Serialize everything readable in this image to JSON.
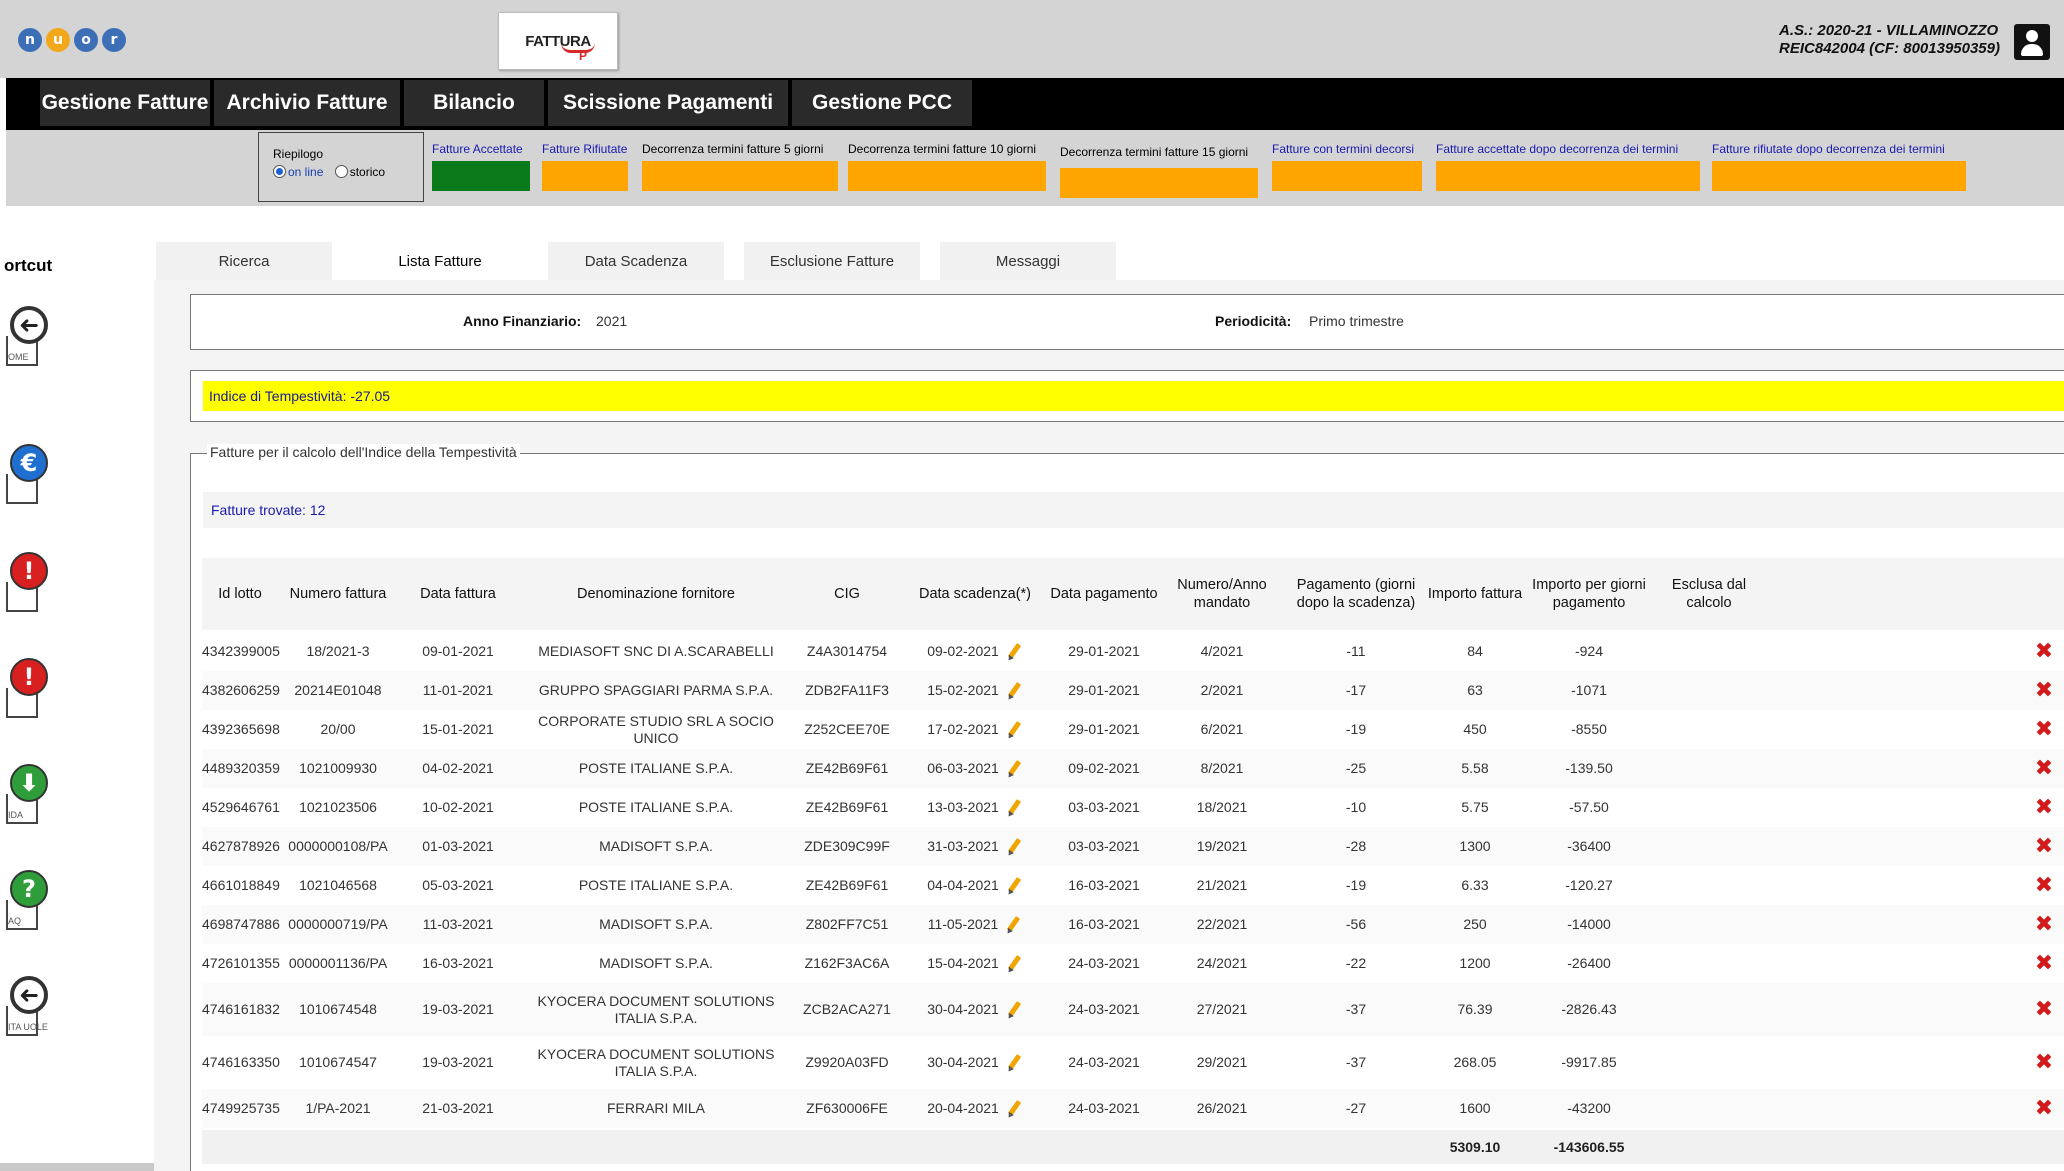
{
  "header": {
    "logo_letters": [
      "n",
      "u",
      "o",
      "r"
    ],
    "logo_colors": [
      "#3d6fb6",
      "#f3a81b",
      "#3d6fb6",
      "#3d6fb6"
    ],
    "fattura_logo": "FATTURA",
    "fattura_logo_sub": "P",
    "school_line1": "A.S.: 2020-21  - VILLAMINOZZO",
    "school_line2": "REIC842004  (CF: 80013950359)"
  },
  "nav": {
    "items": [
      "Gestione Fatture",
      "Archivio Fatture",
      "Bilancio",
      "Scissione Pagamenti",
      "Gestione PCC"
    ]
  },
  "filter": {
    "riepilogo_title": "Riepilogo",
    "option_online": "on line",
    "option_storico": "storico",
    "items": [
      {
        "label": "Fatture Accettate",
        "color": "#0a7a1a"
      },
      {
        "label": "Fatture Rifiutate",
        "color": "#ffa500"
      },
      {
        "label": "Decorrenza termini fatture 5 giorni",
        "color": "#ffa500"
      },
      {
        "label": "Decorrenza termini fatture 10 giorni",
        "color": "#ffa500"
      },
      {
        "label": "Decorrenza termini fatture 15 giorni",
        "color": "#ffa500"
      },
      {
        "label": "Fatture con termini decorsi",
        "color": "#ffa500"
      },
      {
        "label": "Fatture accettate dopo decorrenza dei termini",
        "color": "#ffa500"
      },
      {
        "label": "Fatture rifiutate dopo decorrenza dei termini",
        "color": "#ffa500"
      }
    ]
  },
  "sidebar": {
    "title": "ortcut",
    "shortcuts": [
      {
        "icon": "back-arrow-icon",
        "glyph": "➜",
        "color": "#ffffff",
        "caption": "OME"
      },
      {
        "icon": "euro-icon",
        "glyph": "€",
        "color": "#1f6fd0",
        "caption": ""
      },
      {
        "icon": "warning-icon",
        "glyph": "!",
        "color": "#d82020",
        "caption": ""
      },
      {
        "icon": "warning-icon",
        "glyph": "!",
        "color": "#d82020",
        "caption": ""
      },
      {
        "icon": "download-icon",
        "glyph": "⬇",
        "color": "#2f9e3a",
        "caption": "IDA"
      },
      {
        "icon": "help-icon",
        "glyph": "?",
        "color": "#2f9e3a",
        "caption": "AQ"
      },
      {
        "icon": "back-arrow-icon",
        "glyph": "➜",
        "color": "#ffffff",
        "caption": "ITA UOLE"
      }
    ]
  },
  "tabs": [
    "Ricerca",
    "Lista Fatture",
    "Data Scadenza",
    "Esclusione Fatture",
    "Messaggi"
  ],
  "info": {
    "anno_label": "Anno Finanziario:",
    "anno_value": "2021",
    "periodicita_label": "Periodicità:",
    "periodicita_value": "Primo trimestre"
  },
  "indice": "Indice di Tempestività: -27.05",
  "section": {
    "legend": "Fatture per il calcolo dell'Indice della Tempestività",
    "found": "Fatture trovate: 12"
  },
  "table": {
    "headers": [
      "Id lotto",
      "Numero fattura",
      "Data fattura",
      "Denominazione fornitore",
      "CIG",
      "Data scadenza(*)",
      "Data pagamento",
      "Numero/Anno mandato",
      "Pagamento (giorni dopo la scadenza)",
      "Importo fattura",
      "Importo per giorni pagamento",
      "Esclusa dal calcolo"
    ],
    "rows": [
      [
        "4342399005",
        "18/2021-3",
        "09-01-2021",
        "MEDIASOFT SNC DI A.SCARABELLI",
        "Z4A3014754",
        "09-02-2021",
        "29-01-2021",
        "4/2021",
        "-11",
        "84",
        "-924"
      ],
      [
        "4382606259",
        "20214E01048",
        "11-01-2021",
        "GRUPPO SPAGGIARI PARMA S.P.A.",
        "ZDB2FA11F3",
        "15-02-2021",
        "29-01-2021",
        "2/2021",
        "-17",
        "63",
        "-1071"
      ],
      [
        "4392365698",
        "20/00",
        "15-01-2021",
        "CORPORATE STUDIO SRL A SOCIO UNICO",
        "Z252CEE70E",
        "17-02-2021",
        "29-01-2021",
        "6/2021",
        "-19",
        "450",
        "-8550"
      ],
      [
        "4489320359",
        "1021009930",
        "04-02-2021",
        "POSTE ITALIANE S.P.A.",
        "ZE42B69F61",
        "06-03-2021",
        "09-02-2021",
        "8/2021",
        "-25",
        "5.58",
        "-139.50"
      ],
      [
        "4529646761",
        "1021023506",
        "10-02-2021",
        "POSTE ITALIANE S.P.A.",
        "ZE42B69F61",
        "13-03-2021",
        "03-03-2021",
        "18/2021",
        "-10",
        "5.75",
        "-57.50"
      ],
      [
        "4627878926",
        "0000000108/PA",
        "01-03-2021",
        "MADISOFT S.P.A.",
        "ZDE309C99F",
        "31-03-2021",
        "03-03-2021",
        "19/2021",
        "-28",
        "1300",
        "-36400"
      ],
      [
        "4661018849",
        "1021046568",
        "05-03-2021",
        "POSTE ITALIANE S.P.A.",
        "ZE42B69F61",
        "04-04-2021",
        "16-03-2021",
        "21/2021",
        "-19",
        "6.33",
        "-120.27"
      ],
      [
        "4698747886",
        "0000000719/PA",
        "11-03-2021",
        "MADISOFT S.P.A.",
        "Z802FF7C51",
        "11-05-2021",
        "16-03-2021",
        "22/2021",
        "-56",
        "250",
        "-14000"
      ],
      [
        "4726101355",
        "0000001136/PA",
        "16-03-2021",
        "MADISOFT S.P.A.",
        "Z162F3AC6A",
        "15-04-2021",
        "24-03-2021",
        "24/2021",
        "-22",
        "1200",
        "-26400"
      ],
      [
        "4746161832",
        "1010674548",
        "19-03-2021",
        "KYOCERA DOCUMENT SOLUTIONS ITALIA S.P.A.",
        "ZCB2ACA271",
        "30-04-2021",
        "24-03-2021",
        "27/2021",
        "-37",
        "76.39",
        "-2826.43"
      ],
      [
        "4746163350",
        "1010674547",
        "19-03-2021",
        "KYOCERA DOCUMENT SOLUTIONS ITALIA S.P.A.",
        "Z9920A03FD",
        "30-04-2021",
        "24-03-2021",
        "29/2021",
        "-37",
        "268.05",
        "-9917.85"
      ],
      [
        "4749925735",
        "1/PA-2021",
        "21-03-2021",
        "FERRARI MILA",
        "ZF630006FE",
        "20-04-2021",
        "24-03-2021",
        "26/2021",
        "-27",
        "1600",
        "-43200"
      ]
    ],
    "delete_glyph": "✖",
    "totals": {
      "importo": "5309.10",
      "importo_giorni": "-143606.55"
    }
  }
}
